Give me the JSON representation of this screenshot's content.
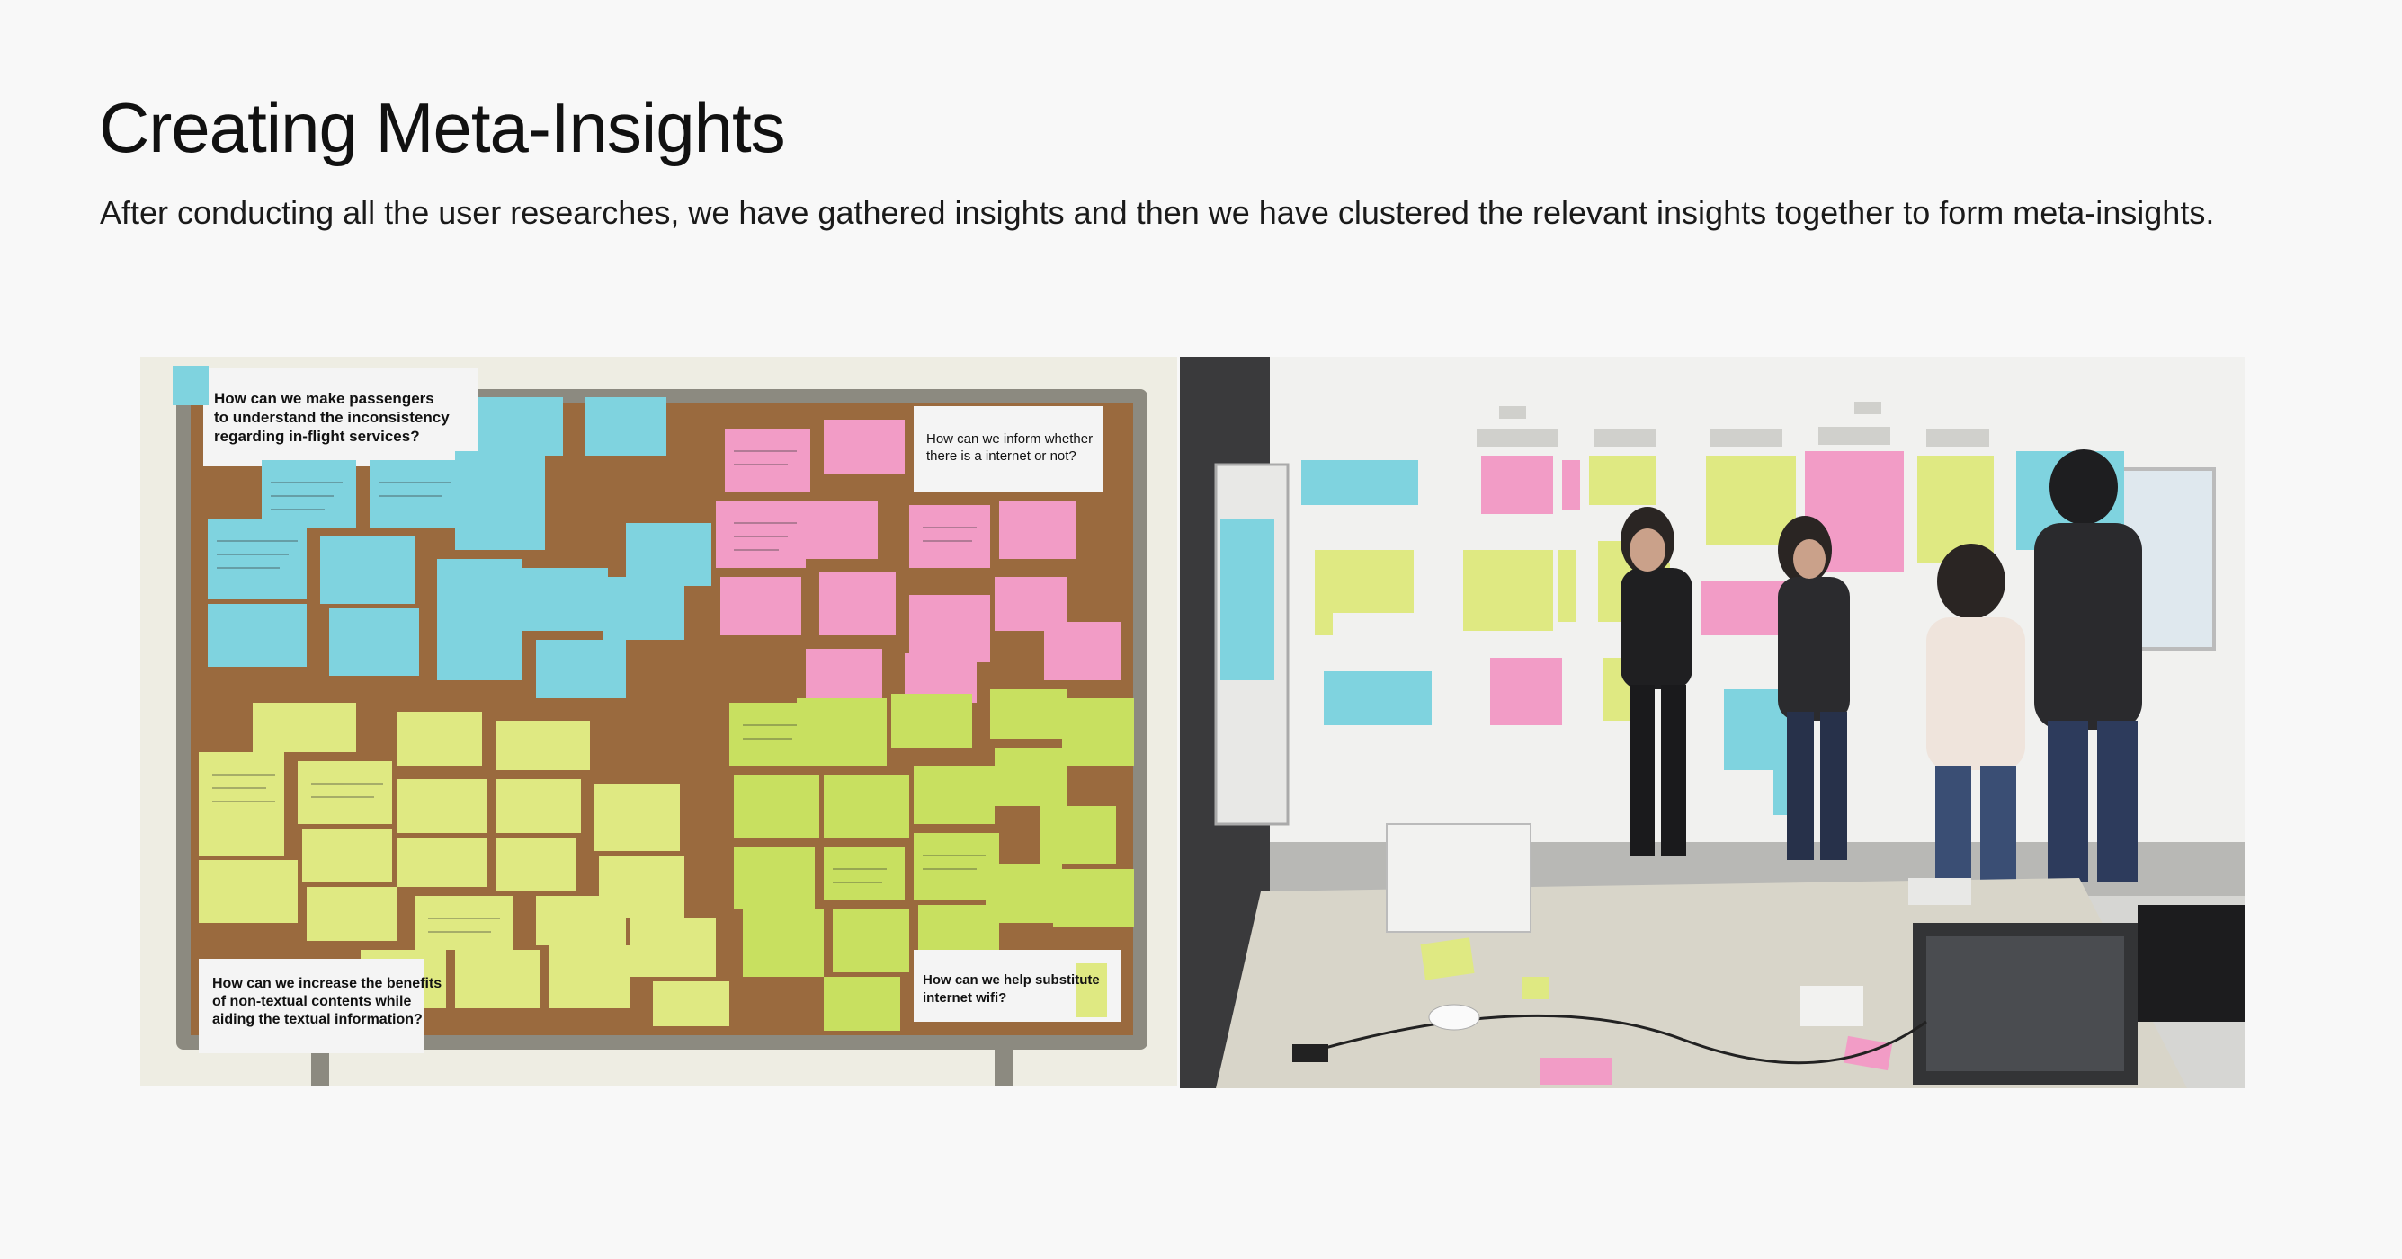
{
  "page": {
    "title": "Creating Meta-Insights",
    "subtitle": "After conducting all the user researches, we have gathered insights and then we have clustered the relevant insights together to form meta-insights."
  },
  "left_photo": {
    "cards": {
      "q1": [
        "How can we make passengers",
        "to understand the inconsistency",
        "regarding in-flight services?"
      ],
      "q2": [
        "How can we inform whether",
        "there is a internet or not?"
      ],
      "q3": [
        "How can we increase the benefits",
        "of non-textual contents while",
        "aiding the textual information?"
      ],
      "q4": [
        "How can we help substitute",
        "internet wifi?"
      ]
    }
  },
  "colors": {
    "background": "#f8f8f8",
    "cork": "#9a6a3e",
    "frame": "#8c8a80",
    "sticky_blue": "#7fd3df",
    "sticky_pink": "#f29cc6",
    "sticky_yellow": "#dfe982"
  }
}
